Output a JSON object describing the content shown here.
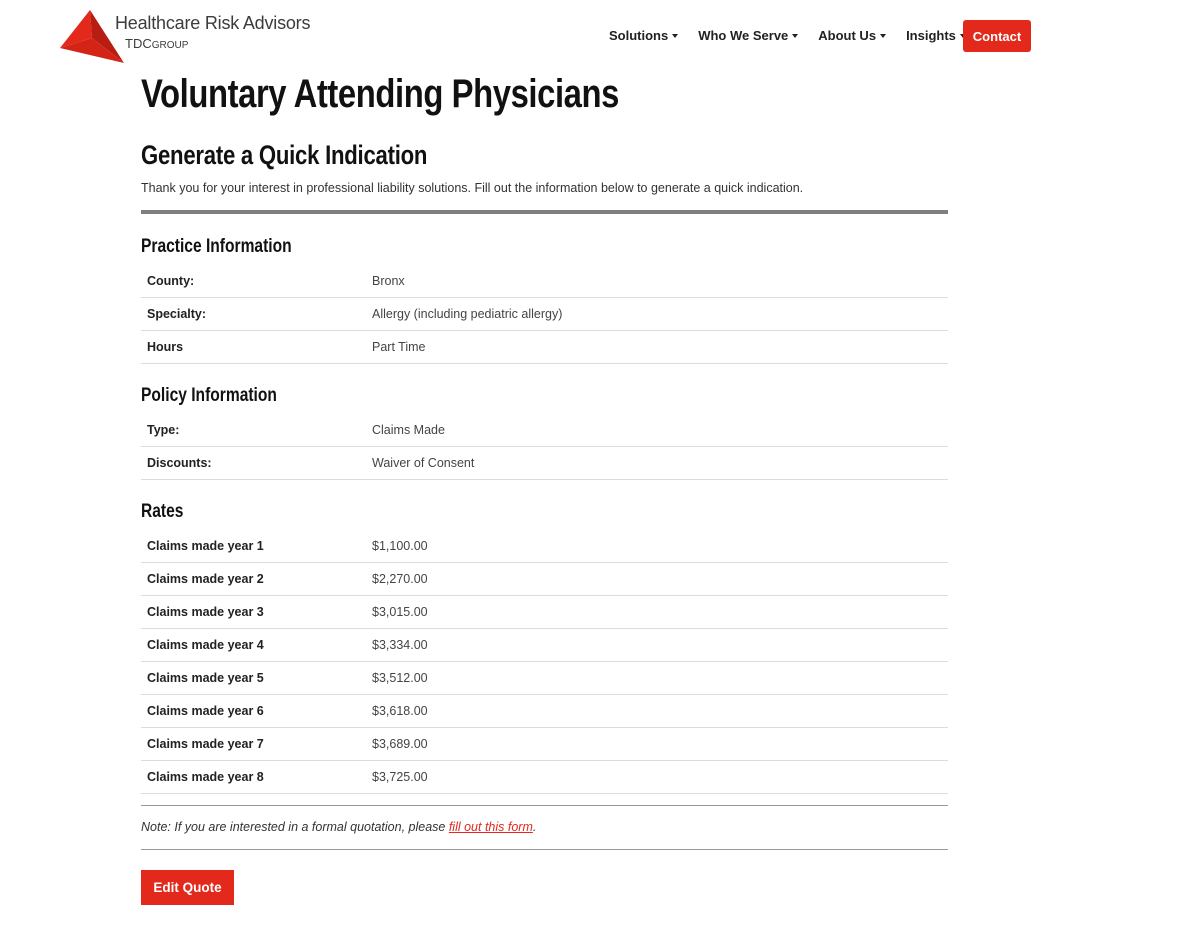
{
  "header": {
    "logo_title": "Healthcare Risk Advisors",
    "logo_sub_main": "TDC",
    "logo_sub_small": "GROUP",
    "nav": [
      "Solutions",
      "Who We Serve",
      "About Us",
      "Insights"
    ],
    "contact_label": "Contact",
    "brand_color": "#e2291c"
  },
  "page": {
    "title": "Voluntary Attending Physicians",
    "subtitle": "Generate a Quick Indication",
    "intro": "Thank you for your interest in professional liability solutions.  Fill out the information below to generate a quick indication."
  },
  "practice": {
    "heading": "Practice Information",
    "rows": [
      {
        "label": "County:",
        "value": "Bronx"
      },
      {
        "label": "Specialty:",
        "value": "Allergy (including pediatric allergy)"
      },
      {
        "label": "Hours",
        "value": "Part Time"
      }
    ]
  },
  "policy": {
    "heading": "Policy Information",
    "rows": [
      {
        "label": "Type:",
        "value": "Claims Made"
      },
      {
        "label": "Discounts:",
        "value": "Waiver of Consent"
      }
    ]
  },
  "rates": {
    "heading": "Rates",
    "rows": [
      {
        "label": "Claims made year 1",
        "value": "$1,100.00"
      },
      {
        "label": "Claims made year 2",
        "value": "$2,270.00"
      },
      {
        "label": "Claims made year 3",
        "value": "$3,015.00"
      },
      {
        "label": "Claims made year 4",
        "value": "$3,334.00"
      },
      {
        "label": "Claims made year 5",
        "value": "$3,512.00"
      },
      {
        "label": "Claims made year 6",
        "value": "$3,618.00"
      },
      {
        "label": "Claims made year 7",
        "value": "$3,689.00"
      },
      {
        "label": "Claims made year 8",
        "value": "$3,725.00"
      }
    ]
  },
  "note": {
    "prefix": "Note: If you are interested in a formal quotation, please ",
    "link": "fill out this form",
    "suffix": "."
  },
  "edit_button": "Edit Quote"
}
